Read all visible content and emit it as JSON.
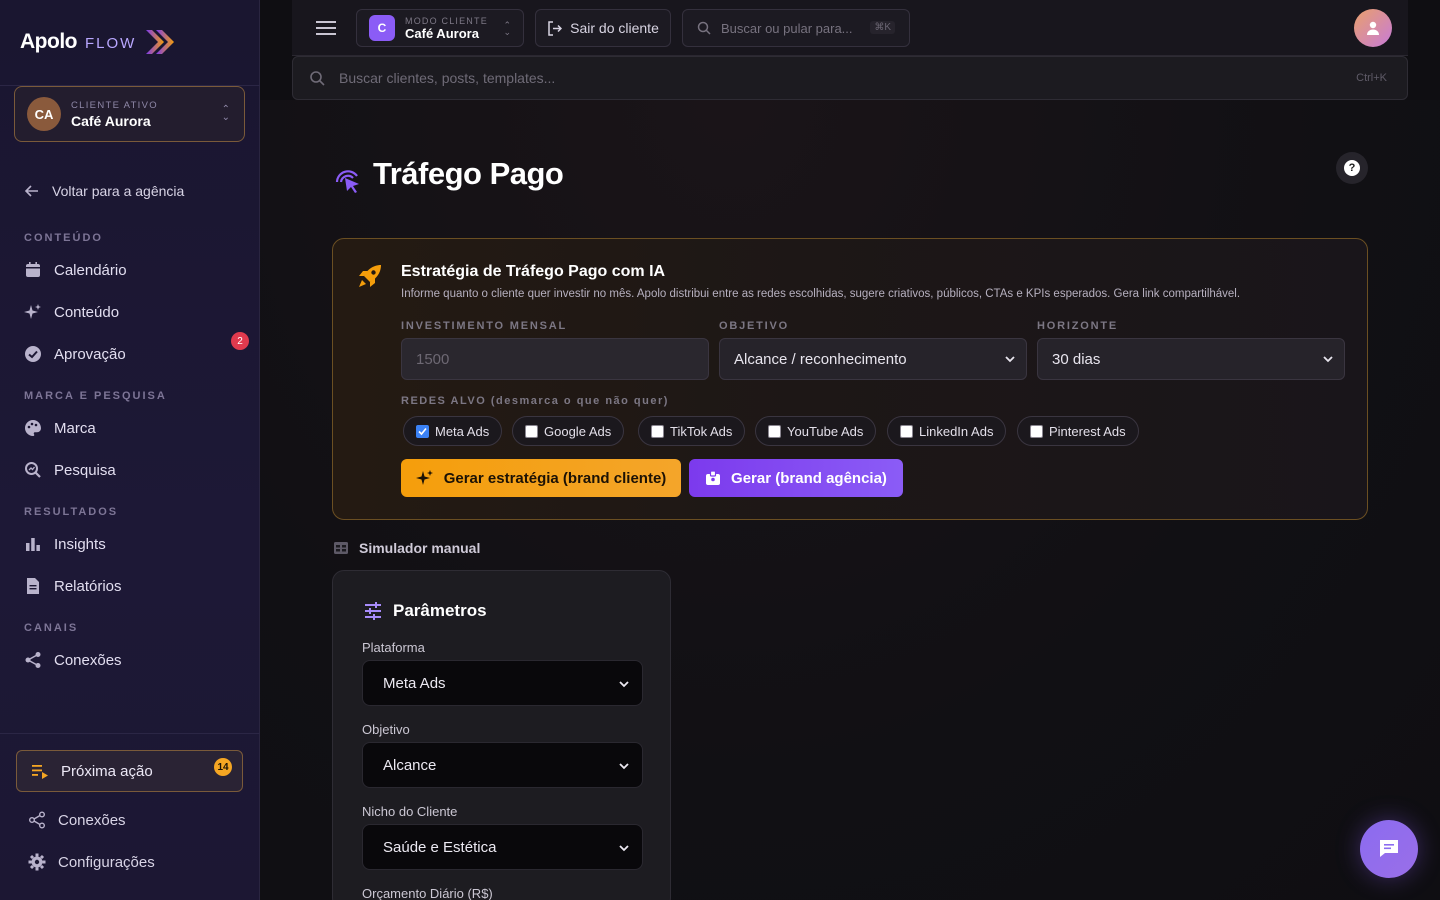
{
  "brand": {
    "name_bold": "Apolo",
    "name_light": "FLOW"
  },
  "active_client": {
    "label": "CLIENTE ATIVO",
    "initials": "CA",
    "name": "Café Aurora"
  },
  "sidebar": {
    "back": "Voltar para a agência",
    "sections": [
      {
        "title": "CONTEÚDO",
        "items": [
          "Calendário",
          "Conteúdo",
          "Aprovação"
        ]
      },
      {
        "title": "MARCA E PESQUISA",
        "items": [
          "Marca",
          "Pesquisa"
        ]
      },
      {
        "title": "RESULTADOS",
        "items": [
          "Insights",
          "Relatórios"
        ]
      },
      {
        "title": "CANAIS",
        "items": [
          "Conexões"
        ]
      }
    ],
    "approval_badge": "2",
    "next_action": {
      "label": "Próxima ação",
      "count": "14"
    },
    "footer": [
      "Conexões",
      "Configurações"
    ]
  },
  "topbar": {
    "mode_label": "MODO CLIENTE",
    "mode_initial": "C",
    "mode_client": "Café Aurora",
    "exit_label": "Sair do cliente",
    "quick_search_placeholder": "Buscar ou pular para...",
    "quick_search_shortcut": "⌘K"
  },
  "global_search": {
    "placeholder": "Buscar clientes, posts, templates...",
    "shortcut": "Ctrl+K"
  },
  "page": {
    "title": "Tráfego Pago",
    "help": "?"
  },
  "ai_strategy": {
    "title": "Estratégia de Tráfego Pago com IA",
    "description": "Informe quanto o cliente quer investir no mês. Apolo distribui entre as redes escolhidas, sugere criativos, públicos, CTAs e KPIs esperados. Gera link compartilhável.",
    "investment_label": "INVESTIMENTO MENSAL",
    "investment_placeholder": "1500",
    "objective_label": "OBJETIVO",
    "objective_value": "Alcance / reconhecimento",
    "horizon_label": "HORIZONTE",
    "horizon_value": "30 dias",
    "networks_label": "REDES ALVO (desmarca o que não quer)",
    "networks": [
      {
        "name": "Meta Ads",
        "checked": true
      },
      {
        "name": "Google Ads",
        "checked": false
      },
      {
        "name": "TikTok Ads",
        "checked": false
      },
      {
        "name": "YouTube Ads",
        "checked": false
      },
      {
        "name": "LinkedIn Ads",
        "checked": false
      },
      {
        "name": "Pinterest Ads",
        "checked": false
      }
    ],
    "generate_client_btn": "Gerar estratégia (brand cliente)",
    "generate_agency_btn": "Gerar (brand agência)"
  },
  "simulator": {
    "label": "Simulador manual",
    "params_title": "Parâmetros",
    "platform_label": "Plataforma",
    "platform_value": "Meta Ads",
    "objective_label": "Objetivo",
    "objective_value": "Alcance",
    "niche_label": "Nicho do Cliente",
    "niche_value": "Saúde e Estética",
    "budget_label": "Orçamento Diário (R$)"
  },
  "colors": {
    "accent_orange": "#f59e0b",
    "accent_purple": "#8b5cf6",
    "badge_red": "#e03a4e"
  }
}
